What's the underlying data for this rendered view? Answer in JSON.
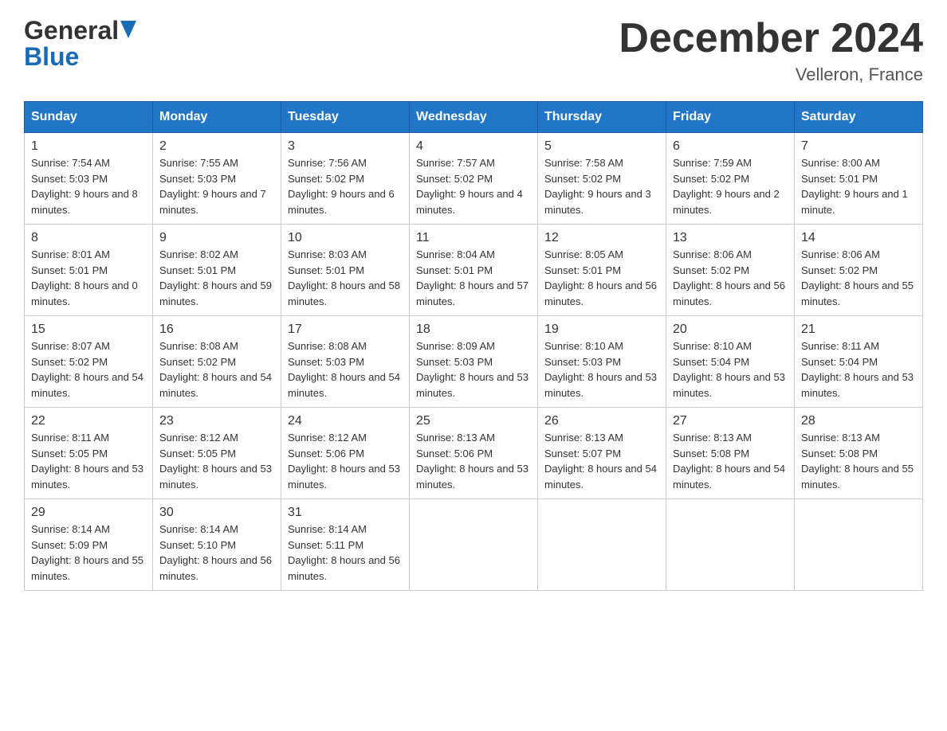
{
  "header": {
    "logo_general": "General",
    "logo_blue": "Blue",
    "main_title": "December 2024",
    "subtitle": "Velleron, France"
  },
  "calendar": {
    "days_of_week": [
      "Sunday",
      "Monday",
      "Tuesday",
      "Wednesday",
      "Thursday",
      "Friday",
      "Saturday"
    ],
    "weeks": [
      [
        {
          "day": "1",
          "sunrise": "7:54 AM",
          "sunset": "5:03 PM",
          "daylight": "9 hours and 8 minutes."
        },
        {
          "day": "2",
          "sunrise": "7:55 AM",
          "sunset": "5:03 PM",
          "daylight": "9 hours and 7 minutes."
        },
        {
          "day": "3",
          "sunrise": "7:56 AM",
          "sunset": "5:02 PM",
          "daylight": "9 hours and 6 minutes."
        },
        {
          "day": "4",
          "sunrise": "7:57 AM",
          "sunset": "5:02 PM",
          "daylight": "9 hours and 4 minutes."
        },
        {
          "day": "5",
          "sunrise": "7:58 AM",
          "sunset": "5:02 PM",
          "daylight": "9 hours and 3 minutes."
        },
        {
          "day": "6",
          "sunrise": "7:59 AM",
          "sunset": "5:02 PM",
          "daylight": "9 hours and 2 minutes."
        },
        {
          "day": "7",
          "sunrise": "8:00 AM",
          "sunset": "5:01 PM",
          "daylight": "9 hours and 1 minute."
        }
      ],
      [
        {
          "day": "8",
          "sunrise": "8:01 AM",
          "sunset": "5:01 PM",
          "daylight": "8 hours and 0 minutes."
        },
        {
          "day": "9",
          "sunrise": "8:02 AM",
          "sunset": "5:01 PM",
          "daylight": "8 hours and 59 minutes."
        },
        {
          "day": "10",
          "sunrise": "8:03 AM",
          "sunset": "5:01 PM",
          "daylight": "8 hours and 58 minutes."
        },
        {
          "day": "11",
          "sunrise": "8:04 AM",
          "sunset": "5:01 PM",
          "daylight": "8 hours and 57 minutes."
        },
        {
          "day": "12",
          "sunrise": "8:05 AM",
          "sunset": "5:01 PM",
          "daylight": "8 hours and 56 minutes."
        },
        {
          "day": "13",
          "sunrise": "8:06 AM",
          "sunset": "5:02 PM",
          "daylight": "8 hours and 56 minutes."
        },
        {
          "day": "14",
          "sunrise": "8:06 AM",
          "sunset": "5:02 PM",
          "daylight": "8 hours and 55 minutes."
        }
      ],
      [
        {
          "day": "15",
          "sunrise": "8:07 AM",
          "sunset": "5:02 PM",
          "daylight": "8 hours and 54 minutes."
        },
        {
          "day": "16",
          "sunrise": "8:08 AM",
          "sunset": "5:02 PM",
          "daylight": "8 hours and 54 minutes."
        },
        {
          "day": "17",
          "sunrise": "8:08 AM",
          "sunset": "5:03 PM",
          "daylight": "8 hours and 54 minutes."
        },
        {
          "day": "18",
          "sunrise": "8:09 AM",
          "sunset": "5:03 PM",
          "daylight": "8 hours and 53 minutes."
        },
        {
          "day": "19",
          "sunrise": "8:10 AM",
          "sunset": "5:03 PM",
          "daylight": "8 hours and 53 minutes."
        },
        {
          "day": "20",
          "sunrise": "8:10 AM",
          "sunset": "5:04 PM",
          "daylight": "8 hours and 53 minutes."
        },
        {
          "day": "21",
          "sunrise": "8:11 AM",
          "sunset": "5:04 PM",
          "daylight": "8 hours and 53 minutes."
        }
      ],
      [
        {
          "day": "22",
          "sunrise": "8:11 AM",
          "sunset": "5:05 PM",
          "daylight": "8 hours and 53 minutes."
        },
        {
          "day": "23",
          "sunrise": "8:12 AM",
          "sunset": "5:05 PM",
          "daylight": "8 hours and 53 minutes."
        },
        {
          "day": "24",
          "sunrise": "8:12 AM",
          "sunset": "5:06 PM",
          "daylight": "8 hours and 53 minutes."
        },
        {
          "day": "25",
          "sunrise": "8:13 AM",
          "sunset": "5:06 PM",
          "daylight": "8 hours and 53 minutes."
        },
        {
          "day": "26",
          "sunrise": "8:13 AM",
          "sunset": "5:07 PM",
          "daylight": "8 hours and 54 minutes."
        },
        {
          "day": "27",
          "sunrise": "8:13 AM",
          "sunset": "5:08 PM",
          "daylight": "8 hours and 54 minutes."
        },
        {
          "day": "28",
          "sunrise": "8:13 AM",
          "sunset": "5:08 PM",
          "daylight": "8 hours and 55 minutes."
        }
      ],
      [
        {
          "day": "29",
          "sunrise": "8:14 AM",
          "sunset": "5:09 PM",
          "daylight": "8 hours and 55 minutes."
        },
        {
          "day": "30",
          "sunrise": "8:14 AM",
          "sunset": "5:10 PM",
          "daylight": "8 hours and 56 minutes."
        },
        {
          "day": "31",
          "sunrise": "8:14 AM",
          "sunset": "5:11 PM",
          "daylight": "8 hours and 56 minutes."
        },
        null,
        null,
        null,
        null
      ]
    ]
  }
}
